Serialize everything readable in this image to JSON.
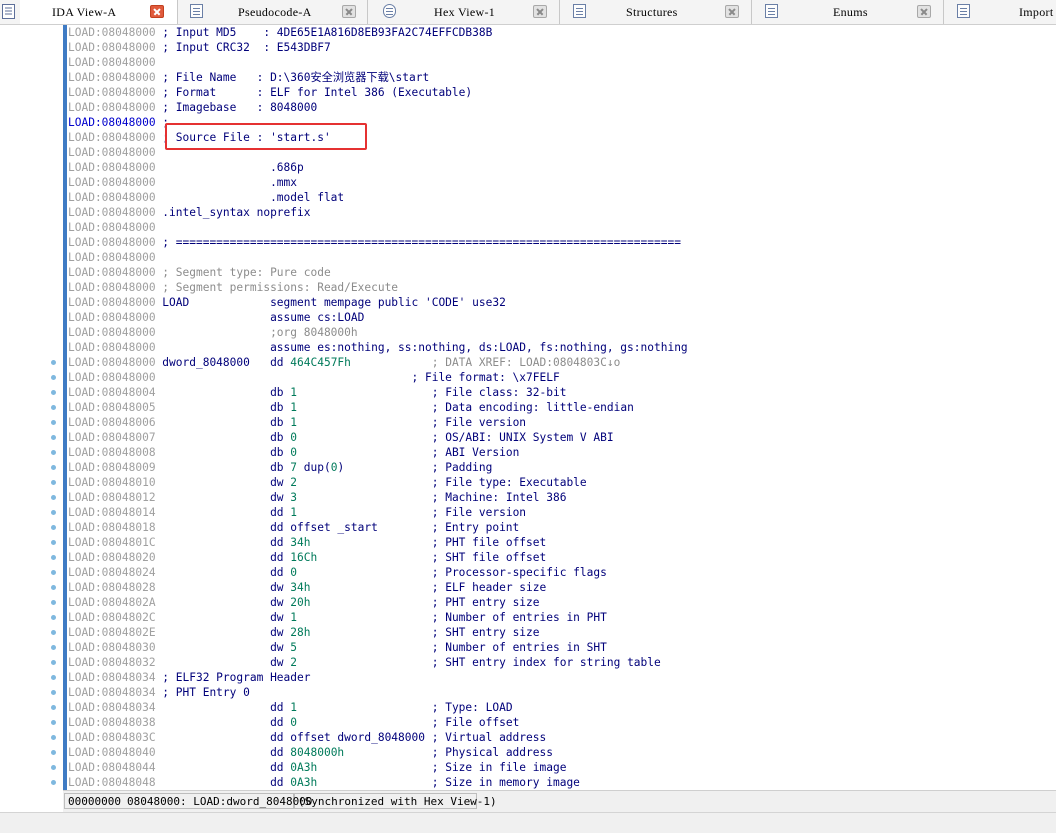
{
  "tabs": [
    {
      "label": "IDA View-A",
      "active": true
    },
    {
      "label": "Pseudocode-A"
    },
    {
      "label": "Hex View-1"
    },
    {
      "label": "Structures"
    },
    {
      "label": "Enums"
    },
    {
      "label": "Import"
    }
  ],
  "lines": [
    {
      "addr": "LOAD:08048000",
      "text": [
        {
          "t": " ; Input MD5    : 4DE65E1A816D8EB93FA2C74EFFCDB38B",
          "c": "k"
        }
      ]
    },
    {
      "addr": "LOAD:08048000",
      "text": [
        {
          "t": " ; Input CRC32  : E543DBF7",
          "c": "k"
        }
      ]
    },
    {
      "addr": "LOAD:08048000",
      "text": []
    },
    {
      "addr": "LOAD:08048000",
      "text": [
        {
          "t": " ; File Name   : D:\\360安全浏览器下载\\start",
          "c": "k"
        }
      ]
    },
    {
      "addr": "LOAD:08048000",
      "text": [
        {
          "t": " ; Format      : ELF for Intel 386 (Executable)",
          "c": "k"
        }
      ]
    },
    {
      "addr": "LOAD:08048000",
      "text": [
        {
          "t": " ; Imagebase   : 8048000",
          "c": "k"
        }
      ]
    },
    {
      "addr": "LOAD:08048000",
      "blue": true,
      "text": [
        {
          "t": " ;",
          "c": "k"
        }
      ]
    },
    {
      "addr": "LOAD:08048000",
      "text": [
        {
          "t": " ; Source File : 'start.s'",
          "c": "k"
        }
      ]
    },
    {
      "addr": "LOAD:08048000",
      "text": []
    },
    {
      "addr": "LOAD:08048000",
      "text": [
        {
          "t": "                 .686p",
          "c": "k"
        }
      ]
    },
    {
      "addr": "LOAD:08048000",
      "text": [
        {
          "t": "                 .mmx",
          "c": "k"
        }
      ]
    },
    {
      "addr": "LOAD:08048000",
      "text": [
        {
          "t": "                 .model flat",
          "c": "k"
        }
      ]
    },
    {
      "addr": "LOAD:08048000",
      "text": [
        {
          "t": " .intel_syntax noprefix",
          "c": "k"
        }
      ]
    },
    {
      "addr": "LOAD:08048000",
      "text": []
    },
    {
      "addr": "LOAD:08048000",
      "text": [
        {
          "t": " ; ===========================================================================",
          "c": "k"
        }
      ]
    },
    {
      "addr": "LOAD:08048000",
      "text": []
    },
    {
      "addr": "LOAD:08048000",
      "text": [
        {
          "t": " ; Segment type: Pure code",
          "c": "g"
        }
      ]
    },
    {
      "addr": "LOAD:08048000",
      "text": [
        {
          "t": " ; Segment permissions: Read/Execute",
          "c": "g"
        }
      ]
    },
    {
      "addr": "LOAD:08048000",
      "text": [
        {
          "t": " LOAD            segment mempage public 'CODE' use32",
          "c": "k"
        }
      ]
    },
    {
      "addr": "LOAD:08048000",
      "text": [
        {
          "t": "                 assume cs:LOAD",
          "c": "k"
        }
      ]
    },
    {
      "addr": "LOAD:08048000",
      "text": [
        {
          "t": "                 ;org 8048000h",
          "c": "g"
        }
      ]
    },
    {
      "addr": "LOAD:08048000",
      "text": [
        {
          "t": "                 assume es:nothing, ss:nothing, ds:LOAD, fs:nothing, gs:nothing",
          "c": "k"
        }
      ]
    },
    {
      "addr": "LOAD:08048000",
      "text": [
        {
          "t": " dword_8048000   dd ",
          "c": "k"
        },
        {
          "t": "464C457Fh",
          "c": "num"
        },
        {
          "t": "            ; DATA XREF: LOAD:0804803C↓o",
          "c": "g"
        }
      ]
    },
    {
      "addr": "LOAD:08048000",
      "text": [
        {
          "t": "                                      ; File format: \\x7FELF",
          "c": "k"
        }
      ]
    },
    {
      "addr": "LOAD:08048004",
      "text": [
        {
          "t": "                 db ",
          "c": "k"
        },
        {
          "t": "1",
          "c": "num"
        },
        {
          "t": "                    ; File class: 32-bit",
          "c": "k"
        }
      ]
    },
    {
      "addr": "LOAD:08048005",
      "text": [
        {
          "t": "                 db ",
          "c": "k"
        },
        {
          "t": "1",
          "c": "num"
        },
        {
          "t": "                    ; Data encoding: little-endian",
          "c": "k"
        }
      ]
    },
    {
      "addr": "LOAD:08048006",
      "text": [
        {
          "t": "                 db ",
          "c": "k"
        },
        {
          "t": "1",
          "c": "num"
        },
        {
          "t": "                    ; File version",
          "c": "k"
        }
      ]
    },
    {
      "addr": "LOAD:08048007",
      "text": [
        {
          "t": "                 db ",
          "c": "k"
        },
        {
          "t": "0",
          "c": "num"
        },
        {
          "t": "                    ; OS/ABI: UNIX System V ABI",
          "c": "k"
        }
      ]
    },
    {
      "addr": "LOAD:08048008",
      "text": [
        {
          "t": "                 db ",
          "c": "k"
        },
        {
          "t": "0",
          "c": "num"
        },
        {
          "t": "                    ; ABI Version",
          "c": "k"
        }
      ]
    },
    {
      "addr": "LOAD:08048009",
      "text": [
        {
          "t": "                 db ",
          "c": "k"
        },
        {
          "t": "7",
          "c": "num"
        },
        {
          "t": " dup(",
          "c": "k"
        },
        {
          "t": "0",
          "c": "num"
        },
        {
          "t": ")             ; Padding",
          "c": "k"
        }
      ]
    },
    {
      "addr": "LOAD:08048010",
      "text": [
        {
          "t": "                 dw ",
          "c": "k"
        },
        {
          "t": "2",
          "c": "num"
        },
        {
          "t": "                    ; File type: Executable",
          "c": "k"
        }
      ]
    },
    {
      "addr": "LOAD:08048012",
      "text": [
        {
          "t": "                 dw ",
          "c": "k"
        },
        {
          "t": "3",
          "c": "num"
        },
        {
          "t": "                    ; Machine: Intel 386",
          "c": "k"
        }
      ]
    },
    {
      "addr": "LOAD:08048014",
      "text": [
        {
          "t": "                 dd ",
          "c": "k"
        },
        {
          "t": "1",
          "c": "num"
        },
        {
          "t": "                    ; File version",
          "c": "k"
        }
      ]
    },
    {
      "addr": "LOAD:08048018",
      "text": [
        {
          "t": "                 dd offset _start        ; Entry point",
          "c": "k"
        }
      ]
    },
    {
      "addr": "LOAD:0804801C",
      "text": [
        {
          "t": "                 dd ",
          "c": "k"
        },
        {
          "t": "34h",
          "c": "num"
        },
        {
          "t": "                  ; PHT file offset",
          "c": "k"
        }
      ]
    },
    {
      "addr": "LOAD:08048020",
      "text": [
        {
          "t": "                 dd ",
          "c": "k"
        },
        {
          "t": "16Ch",
          "c": "num"
        },
        {
          "t": "                 ; SHT file offset",
          "c": "k"
        }
      ]
    },
    {
      "addr": "LOAD:08048024",
      "text": [
        {
          "t": "                 dd ",
          "c": "k"
        },
        {
          "t": "0",
          "c": "num"
        },
        {
          "t": "                    ; Processor-specific flags",
          "c": "k"
        }
      ]
    },
    {
      "addr": "LOAD:08048028",
      "text": [
        {
          "t": "                 dw ",
          "c": "k"
        },
        {
          "t": "34h",
          "c": "num"
        },
        {
          "t": "                  ; ELF header size",
          "c": "k"
        }
      ]
    },
    {
      "addr": "LOAD:0804802A",
      "text": [
        {
          "t": "                 dw ",
          "c": "k"
        },
        {
          "t": "20h",
          "c": "num"
        },
        {
          "t": "                  ; PHT entry size",
          "c": "k"
        }
      ]
    },
    {
      "addr": "LOAD:0804802C",
      "text": [
        {
          "t": "                 dw ",
          "c": "k"
        },
        {
          "t": "1",
          "c": "num"
        },
        {
          "t": "                    ; Number of entries in PHT",
          "c": "k"
        }
      ]
    },
    {
      "addr": "LOAD:0804802E",
      "text": [
        {
          "t": "                 dw ",
          "c": "k"
        },
        {
          "t": "28h",
          "c": "num"
        },
        {
          "t": "                  ; SHT entry size",
          "c": "k"
        }
      ]
    },
    {
      "addr": "LOAD:08048030",
      "text": [
        {
          "t": "                 dw ",
          "c": "k"
        },
        {
          "t": "5",
          "c": "num"
        },
        {
          "t": "                    ; Number of entries in SHT",
          "c": "k"
        }
      ]
    },
    {
      "addr": "LOAD:08048032",
      "text": [
        {
          "t": "                 dw ",
          "c": "k"
        },
        {
          "t": "2",
          "c": "num"
        },
        {
          "t": "                    ; SHT entry index for string table",
          "c": "k"
        }
      ]
    },
    {
      "addr": "LOAD:08048034",
      "text": [
        {
          "t": " ; ELF32 Program Header",
          "c": "k"
        }
      ]
    },
    {
      "addr": "LOAD:08048034",
      "text": [
        {
          "t": " ; PHT Entry 0",
          "c": "k"
        }
      ]
    },
    {
      "addr": "LOAD:08048034",
      "text": [
        {
          "t": "                 dd ",
          "c": "k"
        },
        {
          "t": "1",
          "c": "num"
        },
        {
          "t": "                    ; Type: LOAD",
          "c": "k"
        }
      ]
    },
    {
      "addr": "LOAD:08048038",
      "text": [
        {
          "t": "                 dd ",
          "c": "k"
        },
        {
          "t": "0",
          "c": "num"
        },
        {
          "t": "                    ; File offset",
          "c": "k"
        }
      ]
    },
    {
      "addr": "LOAD:0804803C",
      "text": [
        {
          "t": "                 dd offset dword_8048000 ; Virtual address",
          "c": "k"
        }
      ]
    },
    {
      "addr": "LOAD:08048040",
      "text": [
        {
          "t": "                 dd ",
          "c": "k"
        },
        {
          "t": "8048000h",
          "c": "num"
        },
        {
          "t": "             ; Physical address",
          "c": "k"
        }
      ]
    },
    {
      "addr": "LOAD:08048044",
      "text": [
        {
          "t": "                 dd ",
          "c": "k"
        },
        {
          "t": "0A3h",
          "c": "num"
        },
        {
          "t": "                 ; Size in file image",
          "c": "k"
        }
      ]
    },
    {
      "addr": "LOAD:08048048",
      "text": [
        {
          "t": "                 dd ",
          "c": "k"
        },
        {
          "t": "0A3h",
          "c": "num"
        },
        {
          "t": "                 ; Size in memory image",
          "c": "k"
        }
      ]
    }
  ],
  "status": {
    "offset": "00000000",
    "location": "08048000: LOAD:dword_8048000",
    "sync": "(Synchronized with Hex View-1)"
  },
  "colors": {
    "highlight_box": "#e53131",
    "nav_bar": "#3f7bc4",
    "address": "#a0a0a0",
    "keyword": "#00007a",
    "number": "#007a5a",
    "comment": "#8c8c8c"
  }
}
